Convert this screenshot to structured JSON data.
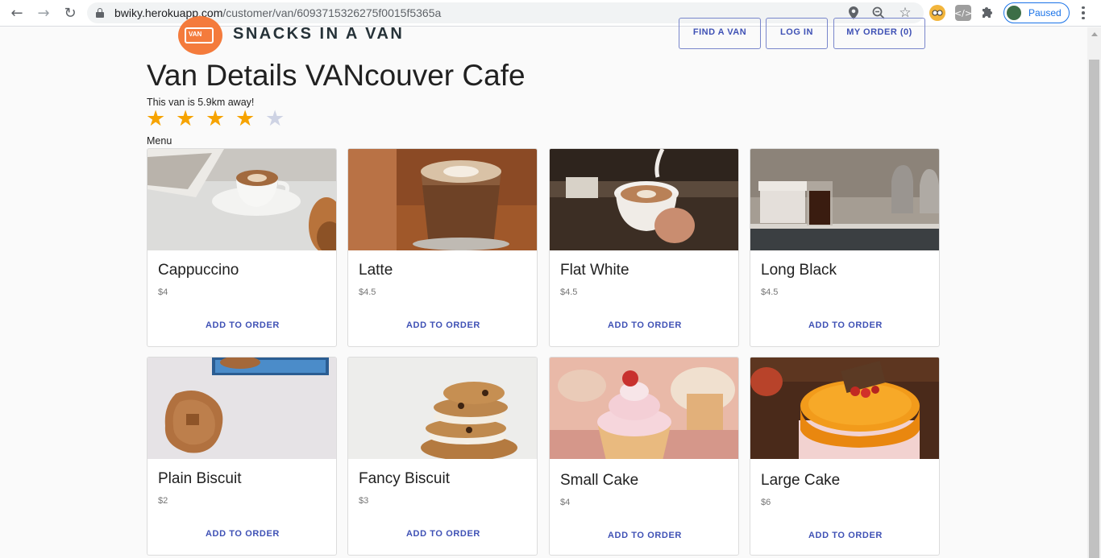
{
  "browser": {
    "url_host": "bwiky.herokuapp.com",
    "url_path": "/customer/van/6093715326275f0015f5365a",
    "profile_status": "Paused",
    "icons": [
      "back-icon",
      "forward-icon",
      "reload-icon",
      "lock-icon",
      "location-icon",
      "zoom-icon",
      "bookmark-star-icon",
      "extension-icon",
      "code-extension-icon",
      "puzzle-icon",
      "menu-dots-icon"
    ]
  },
  "header": {
    "brand": "SNACKS IN A VAN",
    "logo_text": "VAN",
    "nav": {
      "find_van": "FIND A VAN",
      "log_in": "LOG IN",
      "my_order": "MY ORDER (0)"
    }
  },
  "van": {
    "title": "Van Details VANcouver Cafe",
    "distance": "This van is 5.9km away!",
    "rating": 4,
    "rating_max": 5,
    "menu_label": "Menu"
  },
  "menu": [
    {
      "name": "Cappuccino",
      "price": "$4",
      "action": "ADD TO ORDER"
    },
    {
      "name": "Latte",
      "price": "$4.5",
      "action": "ADD TO ORDER"
    },
    {
      "name": "Flat White",
      "price": "$4.5",
      "action": "ADD TO ORDER"
    },
    {
      "name": "Long Black",
      "price": "$4.5",
      "action": "ADD TO ORDER"
    },
    {
      "name": "Plain Biscuit",
      "price": "$2",
      "action": "ADD TO ORDER"
    },
    {
      "name": "Fancy Biscuit",
      "price": "$3",
      "action": "ADD TO ORDER"
    },
    {
      "name": "Small Cake",
      "price": "$4",
      "action": "ADD TO ORDER"
    },
    {
      "name": "Large Cake",
      "price": "$6",
      "action": "ADD TO ORDER"
    }
  ],
  "colors": {
    "accent": "#3f51b5",
    "star_on": "#f6a300",
    "star_off": "#ced3e4",
    "logo": "#f47b3c"
  }
}
